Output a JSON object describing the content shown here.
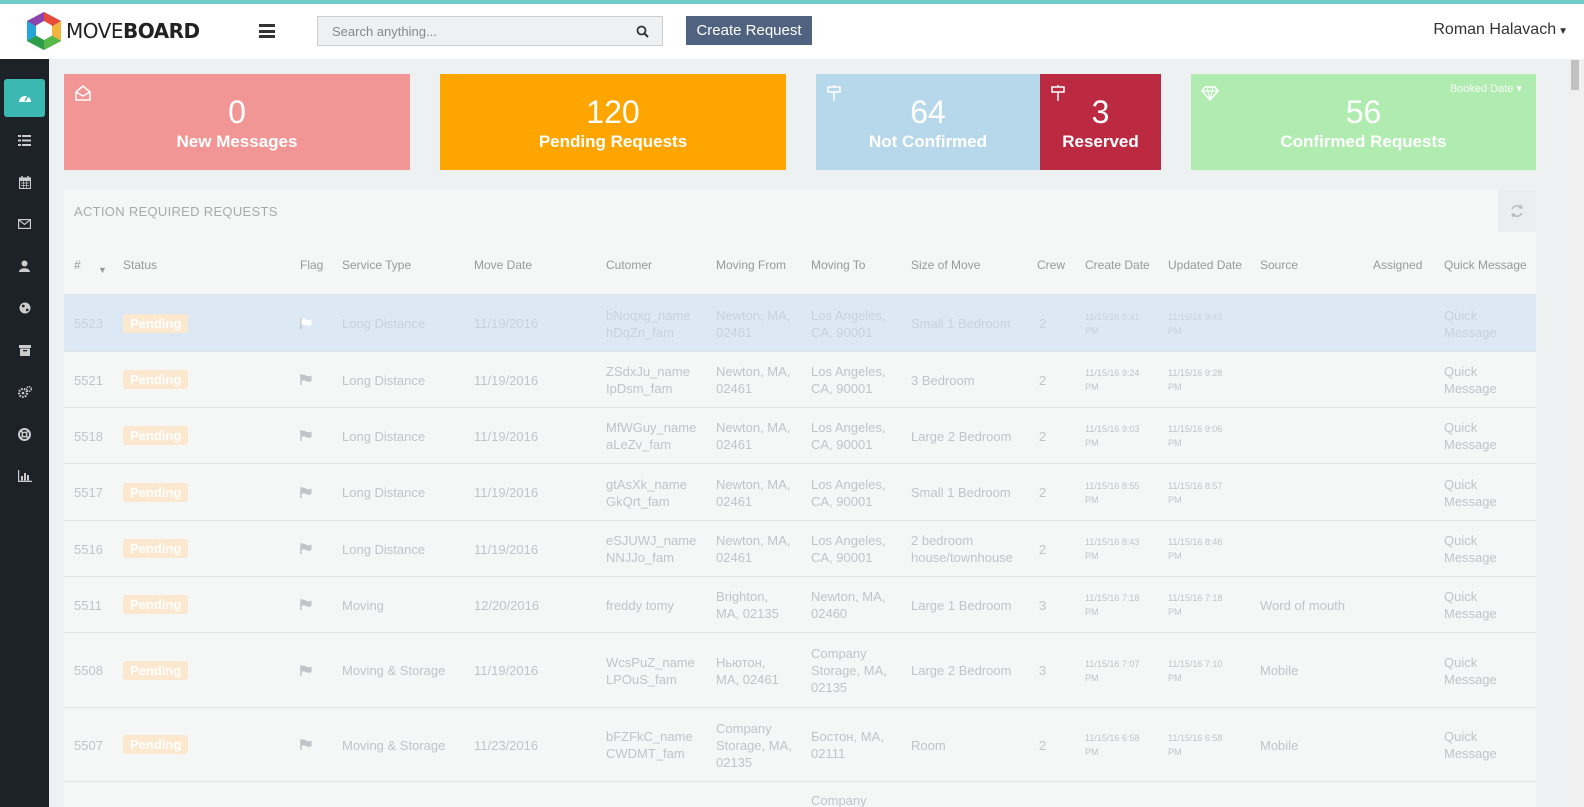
{
  "brand": {
    "logo_prefix": "MOVE",
    "logo_bold": "BOARD"
  },
  "header": {
    "search_placeholder": "Search anything...",
    "create_label": "Create Request",
    "user_name": "Roman Halavach"
  },
  "sidebar": {
    "items": [
      {
        "icon": "dashboard-icon",
        "active": true
      },
      {
        "icon": "list-icon"
      },
      {
        "icon": "calendar-icon"
      },
      {
        "icon": "envelope-icon"
      },
      {
        "icon": "user-icon"
      },
      {
        "icon": "globe-icon"
      },
      {
        "icon": "archive-icon"
      },
      {
        "icon": "gears-icon"
      },
      {
        "icon": "support-icon"
      },
      {
        "icon": "bar-chart-icon"
      }
    ]
  },
  "stats": {
    "new_messages": {
      "value": "0",
      "label": "New Messages",
      "color": "#f29595"
    },
    "pending": {
      "value": "120",
      "label": "Pending Requests",
      "color": "#ffa500"
    },
    "not_confirmed": {
      "value": "64",
      "label": "Not Confirmed",
      "color": "#b7d7ea"
    },
    "reserved": {
      "value": "3",
      "label": "Reserved",
      "color": "#bb2a40"
    },
    "confirmed": {
      "value": "56",
      "label": "Confirmed Requests",
      "color": "#b0ecb0",
      "filter_label": "Booked Date"
    }
  },
  "panel": {
    "title": "ACTION REQUIRED REQUESTS",
    "columns": [
      "#",
      "Status",
      "Flag",
      "Service Type",
      "Move Date",
      "Cutomer",
      "Moving From",
      "Moving To",
      "Size of Move",
      "Crew",
      "Create Date",
      "Updated Date",
      "Source",
      "Assigned",
      "Quick Message"
    ],
    "rows": [
      {
        "id": "5523",
        "status": "Pending",
        "service": "Long Distance",
        "move_date": "11/19/2016",
        "customer1": "bNoqxg_name",
        "customer2": "hDqZn_fam",
        "from1": "Newton, MA,",
        "from2": "02461",
        "from3": "",
        "to1": "Los Angeles,",
        "to2": "CA, 90001",
        "to3": "",
        "size1": "Small 1 Bedroom",
        "size2": "",
        "crew": "2",
        "created1": "11/15/16 9:41",
        "created2": "PM",
        "updated1": "11/15/16 9:43",
        "updated2": "PM",
        "source": "",
        "qm1": "Quick",
        "qm2": "Message"
      },
      {
        "id": "5521",
        "status": "Pending",
        "service": "Long Distance",
        "move_date": "11/19/2016",
        "customer1": "ZSdxJu_name",
        "customer2": "IpDsm_fam",
        "from1": "Newton, MA,",
        "from2": "02461",
        "from3": "",
        "to1": "Los Angeles,",
        "to2": "CA, 90001",
        "to3": "",
        "size1": "3 Bedroom",
        "size2": "",
        "crew": "2",
        "created1": "11/15/16 9:24",
        "created2": "PM",
        "updated1": "11/15/16 9:28",
        "updated2": "PM",
        "source": "",
        "qm1": "Quick",
        "qm2": "Message"
      },
      {
        "id": "5518",
        "status": "Pending",
        "service": "Long Distance",
        "move_date": "11/19/2016",
        "customer1": "MfWGuy_name",
        "customer2": "aLeZv_fam",
        "from1": "Newton, MA,",
        "from2": "02461",
        "from3": "",
        "to1": "Los Angeles,",
        "to2": "CA, 90001",
        "to3": "",
        "size1": "Large 2 Bedroom",
        "size2": "",
        "crew": "2",
        "created1": "11/15/16 9:03",
        "created2": "PM",
        "updated1": "11/15/16 9:06",
        "updated2": "PM",
        "source": "",
        "qm1": "Quick",
        "qm2": "Message"
      },
      {
        "id": "5517",
        "status": "Pending",
        "service": "Long Distance",
        "move_date": "11/19/2016",
        "customer1": "gtAsXk_name",
        "customer2": "GkQrt_fam",
        "from1": "Newton, MA,",
        "from2": "02461",
        "from3": "",
        "to1": "Los Angeles,",
        "to2": "CA, 90001",
        "to3": "",
        "size1": "Small 1 Bedroom",
        "size2": "",
        "crew": "2",
        "created1": "11/15/16 8:55",
        "created2": "PM",
        "updated1": "11/15/16 8:57",
        "updated2": "PM",
        "source": "",
        "qm1": "Quick",
        "qm2": "Message"
      },
      {
        "id": "5516",
        "status": "Pending",
        "service": "Long Distance",
        "move_date": "11/19/2016",
        "customer1": "eSJUWJ_name",
        "customer2": "NNJJo_fam",
        "from1": "Newton, MA,",
        "from2": "02461",
        "from3": "",
        "to1": "Los Angeles,",
        "to2": "CA, 90001",
        "to3": "",
        "size1": "2 bedroom",
        "size2": "house/townhouse",
        "crew": "2",
        "created1": "11/15/16 8:43",
        "created2": "PM",
        "updated1": "11/15/16 8:46",
        "updated2": "PM",
        "source": "",
        "qm1": "Quick",
        "qm2": "Message"
      },
      {
        "id": "5511",
        "status": "Pending",
        "service": "Moving",
        "move_date": "12/20/2016",
        "customer1": "freddy tomy",
        "customer2": "",
        "from1": "Brighton,",
        "from2": "MA, 02135",
        "from3": "",
        "to1": "Newton, MA,",
        "to2": "02460",
        "to3": "",
        "size1": "Large 1 Bedroom",
        "size2": "",
        "crew": "3",
        "created1": "11/15/16 7:18",
        "created2": "PM",
        "updated1": "11/15/16 7:18",
        "updated2": "PM",
        "source": "Word of mouth",
        "qm1": "Quick",
        "qm2": "Message"
      },
      {
        "id": "5508",
        "status": "Pending",
        "service": "Moving & Storage",
        "move_date": "11/19/2016",
        "customer1": "WcsPuZ_name",
        "customer2": "LPOuS_fam",
        "from1": "Ньютон,",
        "from2": "MA, 02461",
        "from3": "",
        "to1": "Company",
        "to2": "Storage, MA,",
        "to3": "02135",
        "size1": "Large 2 Bedroom",
        "size2": "",
        "crew": "3",
        "created1": "11/15/16 7:07",
        "created2": "PM",
        "updated1": "11/15/16 7:10",
        "updated2": "PM",
        "source": "Mobile",
        "qm1": "Quick",
        "qm2": "Message"
      },
      {
        "id": "5507",
        "status": "Pending",
        "service": "Moving & Storage",
        "move_date": "11/23/2016",
        "customer1": "bFZFkC_name",
        "customer2": "CWDMT_fam",
        "from1": "Company",
        "from2": "Storage, MA,",
        "from3": "02135",
        "to1": "Бостон, MA,",
        "to2": "02111",
        "to3": "",
        "size1": "Room",
        "size2": "",
        "crew": "2",
        "created1": "11/15/16 6:58",
        "created2": "PM",
        "updated1": "11/15/16 6:58",
        "updated2": "PM",
        "source": "Mobile",
        "qm1": "Quick",
        "qm2": "Message"
      },
      {
        "id": "",
        "status": "",
        "service": "",
        "move_date": "",
        "customer1": "",
        "customer2": "",
        "from1": "",
        "from2": "",
        "from3": "",
        "to1": "Company",
        "to2": "",
        "to3": "",
        "size1": "",
        "size2": "",
        "crew": "",
        "created1": "",
        "created2": "",
        "updated1": "",
        "updated2": "",
        "source": "",
        "qm1": "",
        "qm2": ""
      }
    ]
  }
}
